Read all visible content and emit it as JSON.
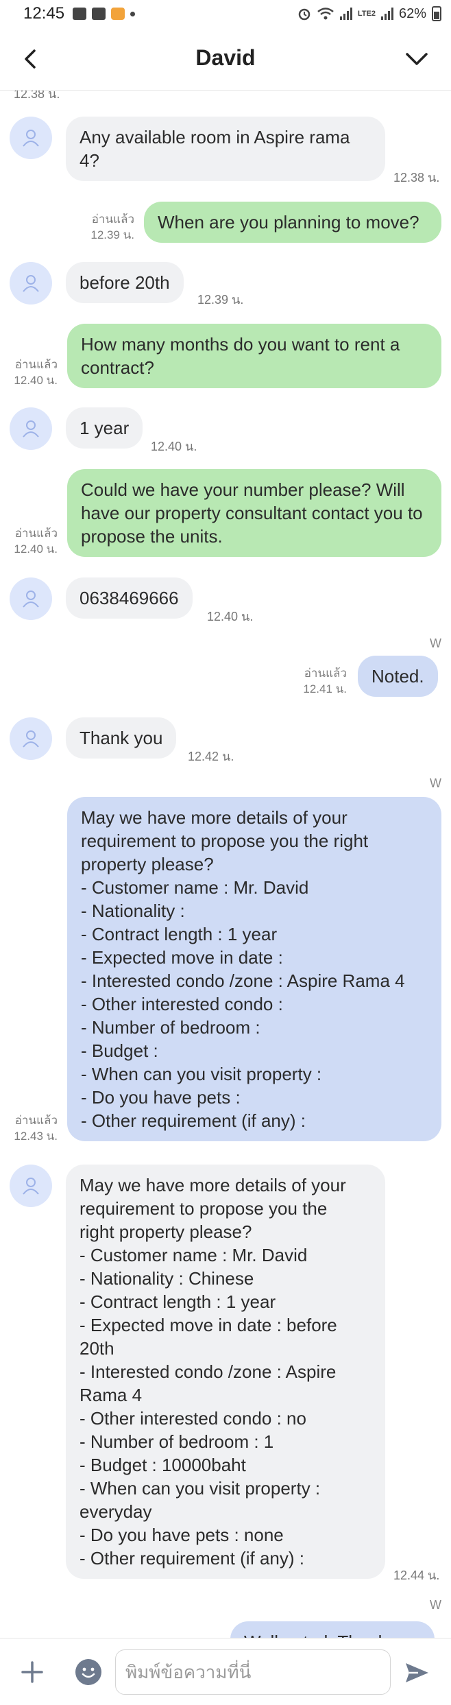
{
  "status_bar": {
    "time": "12:45",
    "battery": "62%",
    "network": "LTE2"
  },
  "header": {
    "title": "David"
  },
  "messages": [
    {
      "text": "Any available room in Aspire rama 4?",
      "time": "12.38 น."
    },
    {
      "text": "When are you planning to move?",
      "read": "อ่านแล้ว",
      "time": "12.39 น."
    },
    {
      "text": "before 20th",
      "time": "12.39 น."
    },
    {
      "text": "How many months do you want to rent a contract?",
      "read": "อ่านแล้ว",
      "time": "12.40 น."
    },
    {
      "text": "1 year",
      "time": "12.40 น."
    },
    {
      "text": "Could we have your number please? Will have our property consultant contact you to propose the units.",
      "read": "อ่านแล้ว",
      "time": "12.40 น."
    },
    {
      "text": "0638469666",
      "time": "12.40 น."
    },
    {
      "text": "Noted.",
      "read": "อ่านแล้ว",
      "time": "12.41 น.",
      "mark": "W"
    },
    {
      "text": "Thank you",
      "time": "12.42 น."
    },
    {
      "text": "May we have more details of your\nrequirement to propose you the right\nproperty please?\n- Customer name : Mr. David\n- Nationality :\n- Contract length : 1 year\n- Expected move in date :\n- Interested condo /zone : Aspire Rama 4\n- Other interested condo :\n- Number of bedroom  :\n- Budget :\n- When can you visit property :\n- Do you have pets :\n- Other requirement (if any) :",
      "read": "อ่านแล้ว",
      "time": "12.43 น.",
      "mark": "W"
    },
    {
      "text": "May we have more details of your\nrequirement to propose you the\nright property please?\n- Customer name : Mr. David\n- Nationality : Chinese\n- Contract length : 1 year\n- Expected move in date : before\n20th\n- Interested condo /zone : Aspire\nRama 4\n- Other interested condo : no\n- Number of bedroom  : 1\n- Budget : 10000baht\n- When can you visit property :\neveryday\n- Do you have pets : none\n- Other requirement (if any) :",
      "time": "12.44 น."
    },
    {
      "text": "Well noted. Thank you",
      "mark": "W"
    }
  ],
  "input": {
    "placeholder": "พิมพ์ข้อความที่นี่"
  }
}
